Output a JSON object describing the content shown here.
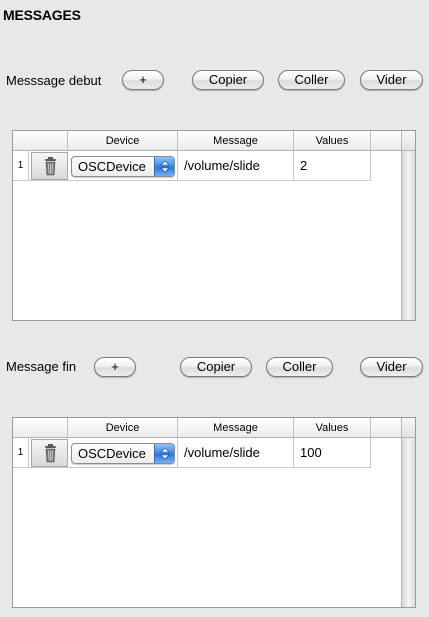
{
  "title": "MESSAGES",
  "sections": [
    {
      "label": "Messsage debut",
      "buttons": {
        "add": "+",
        "copy": "Copier",
        "paste": "Coller",
        "clear": "Vider"
      },
      "columns": [
        "Device",
        "Message",
        "Values"
      ],
      "rows": [
        {
          "index": "1",
          "device": "OSCDevice",
          "message": "/volume/slide",
          "values": "2"
        }
      ]
    },
    {
      "label": "Message fin",
      "buttons": {
        "add": "+",
        "copy": "Copier",
        "paste": "Coller",
        "clear": "Vider"
      },
      "columns": [
        "Device",
        "Message",
        "Values"
      ],
      "rows": [
        {
          "index": "1",
          "device": "OSCDevice",
          "message": "/volume/slide",
          "values": "100"
        }
      ]
    }
  ],
  "icons": {
    "delete": "trash-icon",
    "dropdown": "select-arrows-icon"
  },
  "colors": {
    "background": "#e8e8e8",
    "select_accent": "#3a87ee"
  }
}
